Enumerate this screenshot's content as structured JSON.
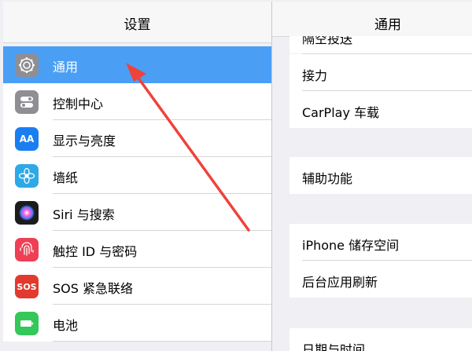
{
  "master": {
    "title": "设置",
    "items": [
      {
        "label": "通用",
        "icon": "gear-icon",
        "color": "#8e8e93",
        "selected": true
      },
      {
        "label": "控制中心",
        "icon": "toggle-icon",
        "color": "#8e8e93"
      },
      {
        "label": "显示与亮度",
        "icon": "text-size-icon",
        "color": "#1a7ef0",
        "glyph": "AA"
      },
      {
        "label": "墙纸",
        "icon": "flower-icon",
        "color": "#2fa9e6"
      },
      {
        "label": "Siri 与搜索",
        "icon": "siri-icon",
        "color": "#1c1c1e"
      },
      {
        "label": "触控 ID 与密码",
        "icon": "fingerprint-icon",
        "color": "#ee3f55"
      },
      {
        "label": "SOS 紧急联络",
        "icon": "sos-icon",
        "color": "#e23a2e",
        "glyph": "SOS"
      },
      {
        "label": "电池",
        "icon": "battery-icon",
        "color": "#34c759"
      }
    ]
  },
  "detail": {
    "title": "通用",
    "top_cut_label": "隔空投送",
    "group1": [
      "接力",
      "CarPlay 车载"
    ],
    "group2": [
      "辅助功能"
    ],
    "group3": [
      "iPhone 储存空间",
      "后台应用刷新"
    ],
    "bottom_cut_label": "日期与时间"
  },
  "colors": {
    "selected": "#4a9ff5",
    "arrow": "#f0423a"
  }
}
